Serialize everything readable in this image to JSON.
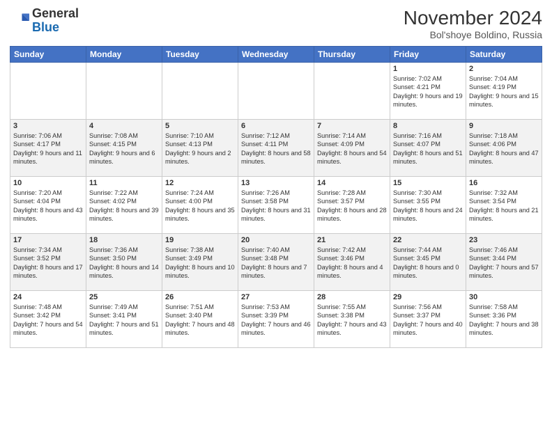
{
  "header": {
    "logo_general": "General",
    "logo_blue": "Blue",
    "title": "November 2024",
    "location": "Bol'shoye Boldino, Russia"
  },
  "weekdays": [
    "Sunday",
    "Monday",
    "Tuesday",
    "Wednesday",
    "Thursday",
    "Friday",
    "Saturday"
  ],
  "weeks": [
    [
      {
        "day": "",
        "content": ""
      },
      {
        "day": "",
        "content": ""
      },
      {
        "day": "",
        "content": ""
      },
      {
        "day": "",
        "content": ""
      },
      {
        "day": "",
        "content": ""
      },
      {
        "day": "1",
        "content": "Sunrise: 7:02 AM\nSunset: 4:21 PM\nDaylight: 9 hours and 19 minutes."
      },
      {
        "day": "2",
        "content": "Sunrise: 7:04 AM\nSunset: 4:19 PM\nDaylight: 9 hours and 15 minutes."
      }
    ],
    [
      {
        "day": "3",
        "content": "Sunrise: 7:06 AM\nSunset: 4:17 PM\nDaylight: 9 hours and 11 minutes."
      },
      {
        "day": "4",
        "content": "Sunrise: 7:08 AM\nSunset: 4:15 PM\nDaylight: 9 hours and 6 minutes."
      },
      {
        "day": "5",
        "content": "Sunrise: 7:10 AM\nSunset: 4:13 PM\nDaylight: 9 hours and 2 minutes."
      },
      {
        "day": "6",
        "content": "Sunrise: 7:12 AM\nSunset: 4:11 PM\nDaylight: 8 hours and 58 minutes."
      },
      {
        "day": "7",
        "content": "Sunrise: 7:14 AM\nSunset: 4:09 PM\nDaylight: 8 hours and 54 minutes."
      },
      {
        "day": "8",
        "content": "Sunrise: 7:16 AM\nSunset: 4:07 PM\nDaylight: 8 hours and 51 minutes."
      },
      {
        "day": "9",
        "content": "Sunrise: 7:18 AM\nSunset: 4:06 PM\nDaylight: 8 hours and 47 minutes."
      }
    ],
    [
      {
        "day": "10",
        "content": "Sunrise: 7:20 AM\nSunset: 4:04 PM\nDaylight: 8 hours and 43 minutes."
      },
      {
        "day": "11",
        "content": "Sunrise: 7:22 AM\nSunset: 4:02 PM\nDaylight: 8 hours and 39 minutes."
      },
      {
        "day": "12",
        "content": "Sunrise: 7:24 AM\nSunset: 4:00 PM\nDaylight: 8 hours and 35 minutes."
      },
      {
        "day": "13",
        "content": "Sunrise: 7:26 AM\nSunset: 3:58 PM\nDaylight: 8 hours and 31 minutes."
      },
      {
        "day": "14",
        "content": "Sunrise: 7:28 AM\nSunset: 3:57 PM\nDaylight: 8 hours and 28 minutes."
      },
      {
        "day": "15",
        "content": "Sunrise: 7:30 AM\nSunset: 3:55 PM\nDaylight: 8 hours and 24 minutes."
      },
      {
        "day": "16",
        "content": "Sunrise: 7:32 AM\nSunset: 3:54 PM\nDaylight: 8 hours and 21 minutes."
      }
    ],
    [
      {
        "day": "17",
        "content": "Sunrise: 7:34 AM\nSunset: 3:52 PM\nDaylight: 8 hours and 17 minutes."
      },
      {
        "day": "18",
        "content": "Sunrise: 7:36 AM\nSunset: 3:50 PM\nDaylight: 8 hours and 14 minutes."
      },
      {
        "day": "19",
        "content": "Sunrise: 7:38 AM\nSunset: 3:49 PM\nDaylight: 8 hours and 10 minutes."
      },
      {
        "day": "20",
        "content": "Sunrise: 7:40 AM\nSunset: 3:48 PM\nDaylight: 8 hours and 7 minutes."
      },
      {
        "day": "21",
        "content": "Sunrise: 7:42 AM\nSunset: 3:46 PM\nDaylight: 8 hours and 4 minutes."
      },
      {
        "day": "22",
        "content": "Sunrise: 7:44 AM\nSunset: 3:45 PM\nDaylight: 8 hours and 0 minutes."
      },
      {
        "day": "23",
        "content": "Sunrise: 7:46 AM\nSunset: 3:44 PM\nDaylight: 7 hours and 57 minutes."
      }
    ],
    [
      {
        "day": "24",
        "content": "Sunrise: 7:48 AM\nSunset: 3:42 PM\nDaylight: 7 hours and 54 minutes."
      },
      {
        "day": "25",
        "content": "Sunrise: 7:49 AM\nSunset: 3:41 PM\nDaylight: 7 hours and 51 minutes."
      },
      {
        "day": "26",
        "content": "Sunrise: 7:51 AM\nSunset: 3:40 PM\nDaylight: 7 hours and 48 minutes."
      },
      {
        "day": "27",
        "content": "Sunrise: 7:53 AM\nSunset: 3:39 PM\nDaylight: 7 hours and 46 minutes."
      },
      {
        "day": "28",
        "content": "Sunrise: 7:55 AM\nSunset: 3:38 PM\nDaylight: 7 hours and 43 minutes."
      },
      {
        "day": "29",
        "content": "Sunrise: 7:56 AM\nSunset: 3:37 PM\nDaylight: 7 hours and 40 minutes."
      },
      {
        "day": "30",
        "content": "Sunrise: 7:58 AM\nSunset: 3:36 PM\nDaylight: 7 hours and 38 minutes."
      }
    ]
  ]
}
